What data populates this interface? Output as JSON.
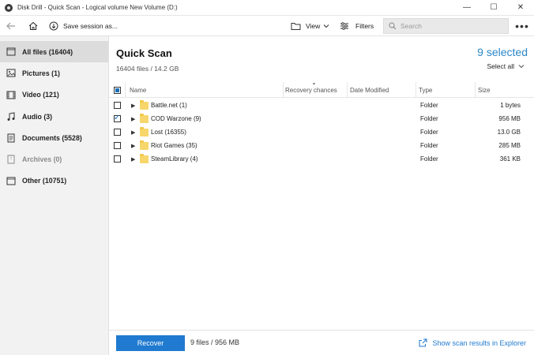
{
  "window": {
    "title": "Disk Drill - Quick Scan - Logical volume New Volume (D:)",
    "minimize_glyph": "—",
    "maximize_glyph": "☐",
    "close_glyph": "✕"
  },
  "toolbar": {
    "back_icon": "arrow-left-icon",
    "home_icon": "home-icon",
    "save_label": "Save session as...",
    "view_label": "View",
    "filters_label": "Filters",
    "search_placeholder": "Search",
    "more_glyph": "•••"
  },
  "sidebar": {
    "items": [
      {
        "label": "All files (16404)",
        "icon": "file-icon",
        "active": true
      },
      {
        "label": "Pictures (1)",
        "icon": "image-icon"
      },
      {
        "label": "Video (121)",
        "icon": "video-icon"
      },
      {
        "label": "Audio (3)",
        "icon": "music-icon"
      },
      {
        "label": "Documents (5528)",
        "icon": "document-icon"
      },
      {
        "label": "Archives (0)",
        "icon": "archive-icon",
        "disabled": true
      },
      {
        "label": "Other (10751)",
        "icon": "other-icon"
      }
    ]
  },
  "main": {
    "title": "Quick Scan",
    "subtitle": "16404 files / 14.2 GB",
    "selected_count": "9 selected",
    "select_all_label": "Select all"
  },
  "table": {
    "headers": {
      "name": "Name",
      "recovery": "Recovery chances",
      "date": "Date Modified",
      "type": "Type",
      "size": "Size"
    },
    "rows": [
      {
        "name": "Battle.net (1)",
        "type": "Folder",
        "size": "1 bytes",
        "checked": false
      },
      {
        "name": "COD Warzone (9)",
        "type": "Folder",
        "size": "956 MB",
        "checked": true
      },
      {
        "name": "Lost (16355)",
        "type": "Folder",
        "size": "13.0 GB",
        "checked": false
      },
      {
        "name": "Riot Games (35)",
        "type": "Folder",
        "size": "285 MB",
        "checked": false
      },
      {
        "name": "SteamLibrary (4)",
        "type": "Folder",
        "size": "361 KB",
        "checked": false
      }
    ]
  },
  "footer": {
    "recover_label": "Recover",
    "info": "9 files / 956 MB",
    "explorer_link": "Show scan results in Explorer"
  },
  "colors": {
    "accent": "#1f7ad0",
    "selected_text": "#2b87c8",
    "folder": "#f7d66b"
  }
}
